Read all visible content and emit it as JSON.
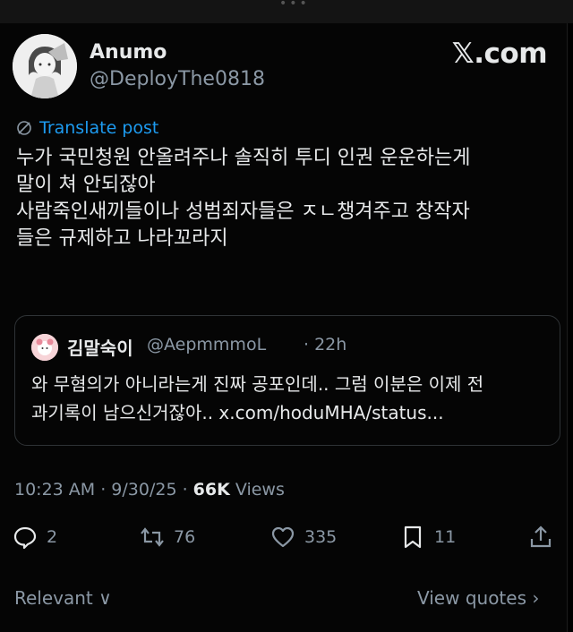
{
  "author": {
    "display_name": "Anumo",
    "handle": "@DeployThe0818"
  },
  "brand": "𝕏.com",
  "translate_label": "Translate post",
  "post_text": "누가 국민청원 안올려주나 솔직히 투디 인권 운운하는게\n말이 쳐 안되잖아\n사람죽인새끼들이나 성범죄자들은 ㅈㄴ챙겨주고 창작자\n들은 규제하고 나라꼬라지",
  "quote": {
    "name": "김말숙이",
    "handle": "@AepmmmoL",
    "time": "· 22h",
    "text": "와 무혐의가 아니라는게 진짜 공포인데.. 그럼 이분은 이제 전\n과기록이 남으신거잖아.. x.com/hoduMHA/status..."
  },
  "meta": {
    "timestamp": "10:23 AM · 9/30/25 · ",
    "views_count": "66K",
    "views_label": " Views"
  },
  "actions": {
    "replies": "2",
    "reposts": "76",
    "likes": "335",
    "bookmarks": "11"
  },
  "footer": {
    "left": "Relevant ∨",
    "right": "View quotes ›"
  },
  "colors": {
    "background": "#000000",
    "text": "#e7e9ea",
    "secondary": "#8b98a5",
    "link": "#1d9bf0",
    "border": "#2f3336"
  }
}
